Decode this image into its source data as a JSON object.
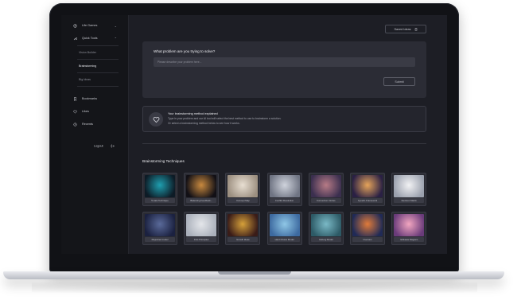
{
  "colors": {
    "screen_bg": "#1d1e25",
    "sidebar_bg": "#141519",
    "panel_bg": "#2b2c35",
    "text_primary": "#f0f0f4",
    "text_muted": "#8e909a"
  },
  "sidebar": {
    "top_item": {
      "label": "Life Games",
      "icon": "puzzle-icon"
    },
    "quick_tools": {
      "label": "Quick Tools",
      "icon": "wrench-icon"
    },
    "sub_items": [
      {
        "label": "Vision Builder",
        "active": false
      },
      {
        "label": "Brainstorming",
        "active": true
      },
      {
        "label": "Big Ideas",
        "active": false
      }
    ],
    "nav_items": [
      {
        "label": "Bookmarks",
        "icon": "bookmark-icon"
      },
      {
        "label": "Likes",
        "icon": "heart-icon"
      },
      {
        "label": "Recents",
        "icon": "clock-icon"
      }
    ],
    "logout_label": "Logout"
  },
  "header": {
    "saved_ideas_label": "Saved Ideas"
  },
  "problem_panel": {
    "title": "What problem are you trying to solve?",
    "placeholder": "Please describe your problem here...",
    "submit_label": "Submit"
  },
  "info_box": {
    "title": "Your brainstorming method explained",
    "lines": [
      "Type in your problem and our AI tool will select the best method to use to brainstorm a solution.",
      "Or select a brainstorming method below to see how it works."
    ]
  },
  "techniques": {
    "title": "Brainstorming Techniques",
    "items": [
      {
        "label": "5 Hats Technique",
        "colors": [
          "#1f9fb0",
          "#0d1b26"
        ]
      },
      {
        "label": "Balancing Feedback...",
        "colors": [
          "#c98a3f",
          "#121016"
        ]
      },
      {
        "label": "Concept Map",
        "colors": [
          "#e8dfd2",
          "#9c8f80"
        ]
      },
      {
        "label": "Conflict Resolution",
        "colors": [
          "#cfd3dc",
          "#6f7483"
        ]
      },
      {
        "label": "Connection Circles",
        "colors": [
          "#b77b86",
          "#3b2f4f"
        ]
      },
      {
        "label": "Cynefin Framework",
        "colors": [
          "#e6a45a",
          "#2a2044"
        ]
      },
      {
        "label": "Decision Matrix",
        "colors": [
          "#f2f2f4",
          "#9aa0ad"
        ]
      },
      {
        "label": "Disjointed model",
        "colors": [
          "#5a6a9a",
          "#1b2140"
        ]
      },
      {
        "label": "First Principles",
        "colors": [
          "#e4e6ea",
          "#aab0bb"
        ]
      },
      {
        "label": "Growth Ideas",
        "colors": [
          "#d6a13a",
          "#3a1c18"
        ]
      },
      {
        "label": "Hard Choice Model",
        "colors": [
          "#8fc7e6",
          "#3d6aa0"
        ]
      },
      {
        "label": "Iceberg Model",
        "colors": [
          "#7ab9c6",
          "#2d5a66"
        ]
      },
      {
        "label": "Inversion",
        "colors": [
          "#e07b3a",
          "#202a56"
        ]
      },
      {
        "label": "Ishikawa Diagram",
        "colors": [
          "#f2a6c0",
          "#6a3b7a"
        ]
      }
    ]
  }
}
